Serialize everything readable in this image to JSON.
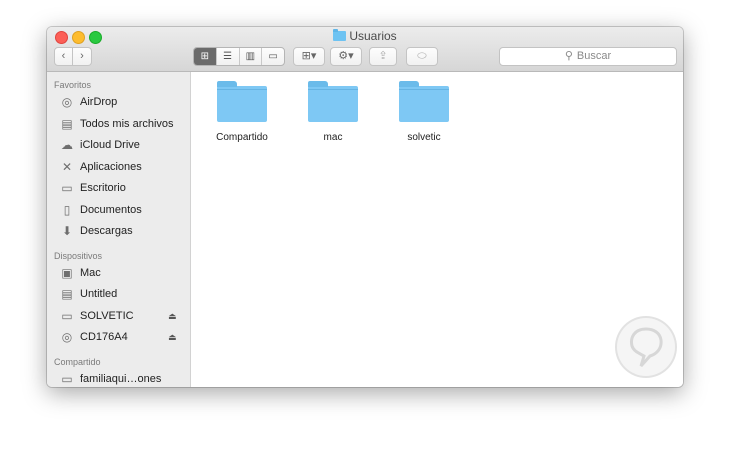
{
  "window": {
    "title": "Usuarios",
    "title_icon": "folder-icon"
  },
  "toolbar": {
    "back_glyph": "‹",
    "forward_glyph": "›",
    "views": [
      {
        "name": "icon-view",
        "glyph": "⊞",
        "active": true
      },
      {
        "name": "list-view",
        "glyph": "☰",
        "active": false
      },
      {
        "name": "column-view",
        "glyph": "▥",
        "active": false
      },
      {
        "name": "coverflow-view",
        "glyph": "▭",
        "active": false
      }
    ],
    "arrange_glyph": "⊞▾",
    "action_glyph": "⚙▾",
    "share_glyph": "⇪",
    "tag_glyph": "⬭",
    "search_placeholder": "Buscar",
    "search_icon": "magnifier-icon"
  },
  "sidebar": {
    "favorites_header": "Favoritos",
    "favorites": [
      {
        "label": "AirDrop",
        "icon": "airdrop-icon",
        "glyph": "◎"
      },
      {
        "label": "Todos mis archivos",
        "icon": "all-files-icon",
        "glyph": "▤"
      },
      {
        "label": "iCloud Drive",
        "icon": "cloud-icon",
        "glyph": "☁"
      },
      {
        "label": "Aplicaciones",
        "icon": "applications-icon",
        "glyph": "✕"
      },
      {
        "label": "Escritorio",
        "icon": "desktop-icon",
        "glyph": "▭"
      },
      {
        "label": "Documentos",
        "icon": "documents-icon",
        "glyph": "▯"
      },
      {
        "label": "Descargas",
        "icon": "downloads-icon",
        "glyph": "⬇"
      }
    ],
    "devices_header": "Dispositivos",
    "devices": [
      {
        "label": "Mac",
        "icon": "computer-icon",
        "glyph": "▣",
        "eject": false
      },
      {
        "label": "Untitled",
        "icon": "drive-icon",
        "glyph": "▤",
        "eject": false
      },
      {
        "label": "SOLVETIC",
        "icon": "external-drive-icon",
        "glyph": "▭",
        "eject": true
      },
      {
        "label": "CD176A4",
        "icon": "disc-icon",
        "glyph": "◎",
        "eject": true
      }
    ],
    "shared_header": "Compartido",
    "shared": [
      {
        "label": "familiaqui…ones",
        "icon": "shared-computer-icon",
        "glyph": "▭"
      }
    ],
    "eject_glyph": "⏏"
  },
  "content": {
    "folders": [
      {
        "label": "Compartido"
      },
      {
        "label": "mac"
      },
      {
        "label": "solvetic"
      }
    ]
  },
  "colors": {
    "folder": "#7ec8f4",
    "sidebar_bg": "#ececec",
    "titlebar_top": "#ececec",
    "titlebar_bottom": "#d6d6d6"
  }
}
